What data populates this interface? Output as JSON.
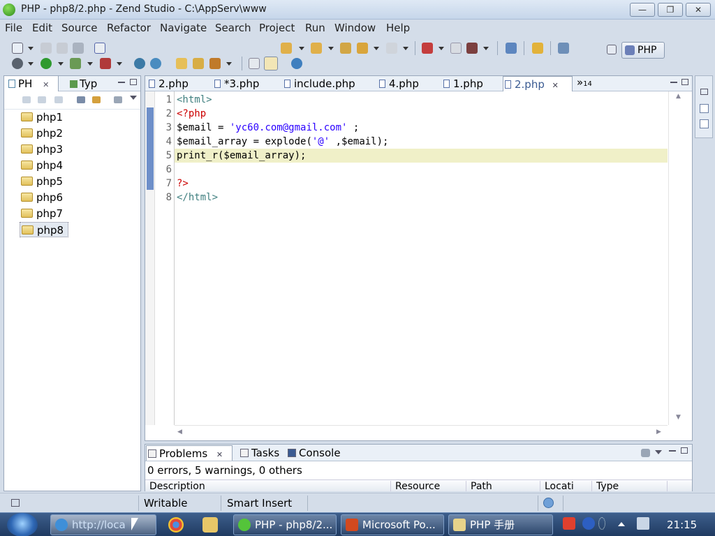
{
  "window": {
    "title": "PHP - php8/2.php - Zend Studio - C:\\AppServ\\www",
    "controls": {
      "minimize": "—",
      "maximize": "❐",
      "close": "✕"
    }
  },
  "menu": [
    "File",
    "Edit",
    "Source",
    "Refactor",
    "Navigate",
    "Search",
    "Project",
    "Run",
    "Window",
    "Help"
  ],
  "perspective": {
    "label": "PHP"
  },
  "left_panel": {
    "tabs": [
      {
        "label": "PH",
        "close": "✕"
      },
      {
        "label": "Typ"
      }
    ],
    "projects": [
      "php1",
      "php2",
      "php3",
      "php4",
      "php5",
      "php6",
      "php7",
      "php8"
    ],
    "selected": "php8"
  },
  "editor": {
    "tabs": [
      {
        "label": "2.php"
      },
      {
        "label": "*3.php"
      },
      {
        "label": "include.php"
      },
      {
        "label": "4.php"
      },
      {
        "label": "1.php"
      },
      {
        "label": "2.php",
        "active": true,
        "close": "✕"
      }
    ],
    "overflow": "»",
    "overflow_count": "14",
    "line_numbers": [
      "1",
      "2",
      "3",
      "4",
      "5",
      "6",
      "7",
      "8"
    ],
    "current_line": 5,
    "lines": [
      [
        {
          "t": "<html>",
          "c": "#3f7f7f"
        }
      ],
      [
        {
          "t": "<?php",
          "c": "#cc0000"
        }
      ],
      [
        {
          "t": "$email",
          "c": "#000000"
        },
        {
          "t": " = ",
          "c": "#000000"
        },
        {
          "t": "'yc60.com@gmail.com'",
          "c": "#2a00ff"
        },
        {
          "t": " ;",
          "c": "#000000"
        }
      ],
      [
        {
          "t": "$email_array",
          "c": "#000000"
        },
        {
          "t": " = explode(",
          "c": "#000000"
        },
        {
          "t": "'@'",
          "c": "#2a00ff"
        },
        {
          "t": " ,$email);",
          "c": "#000000"
        }
      ],
      [
        {
          "t": "print_r($email_array);",
          "c": "#000000"
        }
      ],
      [],
      [
        {
          "t": "?>",
          "c": "#cc0000"
        }
      ],
      [
        {
          "t": "</html>",
          "c": "#3f7f7f"
        }
      ]
    ],
    "scroll": {
      "up": "▲",
      "down": "▼",
      "left": "◀",
      "right": "▶"
    }
  },
  "bottom_panel": {
    "tabs": [
      {
        "label": "Problems",
        "active": true,
        "close": "✕"
      },
      {
        "label": "Tasks"
      },
      {
        "label": "Console"
      }
    ],
    "summary": "0 errors, 5 warnings, 0 others",
    "columns": [
      "Description",
      "Resource",
      "Path",
      "Locati",
      "Type"
    ]
  },
  "statusbar": {
    "mode": "Writable",
    "insert": "Smart Insert"
  },
  "taskbar": {
    "items": [
      {
        "label": "http://loca",
        "icon": "ie-icon"
      },
      {
        "label": "PHP - php8/2...",
        "icon": "zend-icon"
      },
      {
        "label": "Microsoft Po...",
        "icon": "powerpoint-icon"
      },
      {
        "label": "PHP 手册",
        "icon": "help-icon"
      }
    ],
    "clock": "21:15"
  },
  "colors": {
    "chrome": "#d4dde9",
    "active_tab_text": "#3b5b92",
    "current_line": "#f0f0c8",
    "taskbar": "#2a4a75"
  }
}
